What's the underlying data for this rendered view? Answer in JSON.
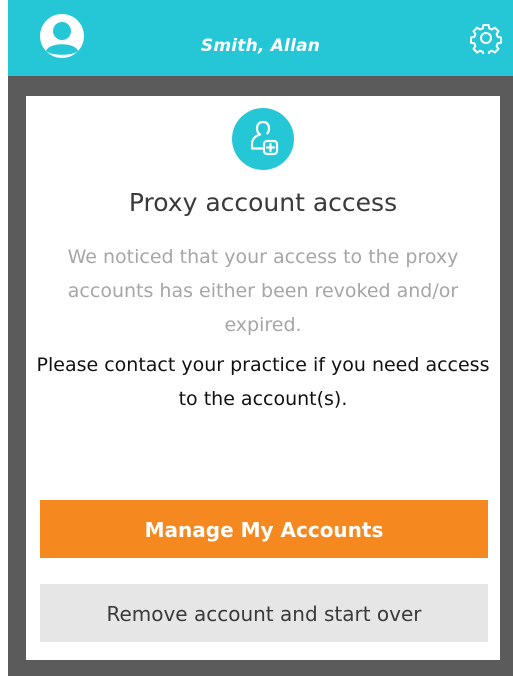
{
  "header": {
    "user_name": "Smith, Allan",
    "avatar_icon": "user-avatar-icon",
    "settings_icon": "gear-icon"
  },
  "dialog": {
    "badge_icon": "proxy-user-plus-icon",
    "title": "Proxy account access",
    "notice": "We noticed that your access to the proxy accounts has either been revoked and/or expired.",
    "contact_message": "Please contact your practice if you need access to the account(s).",
    "primary_button": "Manage My Accounts",
    "secondary_button": "Remove account and start over"
  },
  "colors": {
    "header_bg": "#25c6d6",
    "primary_button_bg": "#f5891f",
    "secondary_button_bg": "#e6e6e6",
    "backdrop": "#5b5b5b"
  }
}
